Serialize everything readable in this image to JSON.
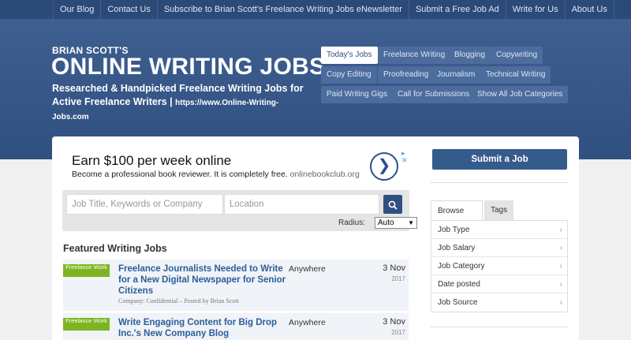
{
  "topnav": [
    "Our Blog",
    "Contact Us",
    "Subscribe to Brian Scott's Freelance Writing Jobs eNewsletter",
    "Submit a Free Job Ad",
    "Write for Us",
    "About Us"
  ],
  "brand": {
    "small": "BRIAN SCOTT'S",
    "title": "ONLINE WRITING JOBS",
    "tagline": "Researched & Handpicked Freelance Writing Jobs for Active Freelance Writers |",
    "url": "https://www.Online-Writing-Jobs.com"
  },
  "categories": [
    "Today's Jobs",
    "Freelance Writing",
    "Blogging",
    "Copywriting",
    "Copy Editing",
    "Proofreading",
    "Journalism",
    "Technical Writing",
    "Paid Writing Gigs",
    "Call for Submissions",
    "Show All Job Categories"
  ],
  "ad": {
    "headline": "Earn $100 per week online",
    "sub": "Become a professional book reviewer. It is completely free.",
    "domain": "onlinebookclub.org",
    "arrow": "❯"
  },
  "search": {
    "keywords_placeholder": "Job Title, Keywords or Company",
    "location_placeholder": "Location",
    "radius_label": "Radius:",
    "radius_value": "Auto"
  },
  "featured_heading": "Featured Writing Jobs",
  "jobs": [
    {
      "badge": "Freelance Work",
      "title": "Freelance Journalists Needed to Write for a New Digital Newspaper for Senior Citizens",
      "location": "Anywhere",
      "day": "3 Nov",
      "year": "2017",
      "meta": "Company: Confidential – Posted by Brian Scott"
    },
    {
      "badge": "Freelance Work",
      "title": "Write Engaging Content for Big Drop Inc.'s New Company Blog",
      "location": "Anywhere",
      "day": "3 Nov",
      "year": "2017",
      "meta": ""
    }
  ],
  "sidebar": {
    "submit": "Submit a Job",
    "tabs": [
      "Browse by...",
      "Tags"
    ],
    "browse": [
      "Job Type",
      "Job Salary",
      "Job Category",
      "Date posted",
      "Job Source"
    ]
  }
}
